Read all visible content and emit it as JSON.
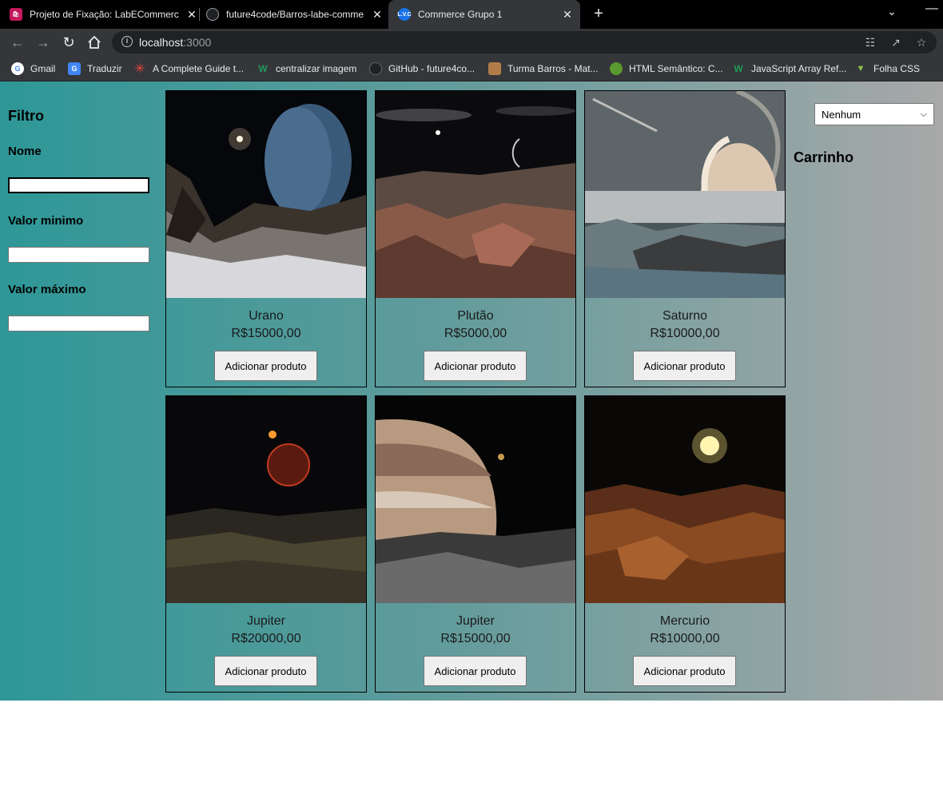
{
  "browser": {
    "tabs": [
      {
        "title": "Projeto de Fixação: LabECommerce",
        "active": false,
        "icon": "bag-icon"
      },
      {
        "title": "future4code/Barros-labe-commerce",
        "active": false,
        "icon": "github-icon"
      },
      {
        "title": "Commerce Grupo 1",
        "active": true,
        "icon": "lvc-icon",
        "icon_text": "L.V.C"
      }
    ],
    "url_host": "localhost",
    "url_port": ":3000",
    "bookmarks": [
      {
        "label": "Gmail",
        "icon": "google-icon",
        "color": "#ffffff"
      },
      {
        "label": "Traduzir",
        "icon": "translate-icon",
        "color": "#4285f4"
      },
      {
        "label": "A Complete Guide t...",
        "icon": "asterisk-icon",
        "color": "#e8453c"
      },
      {
        "label": "centralizar imagem",
        "icon": "w-icon",
        "color": "#1e9a5a"
      },
      {
        "label": "GitHub - future4co...",
        "icon": "github-icon",
        "color": "#202124"
      },
      {
        "label": "Turma Barros - Mat...",
        "icon": "avatar-icon",
        "color": "#b07d48"
      },
      {
        "label": "HTML Semântico: C...",
        "icon": "globe-icon",
        "color": "#5a9a2e"
      },
      {
        "label": "JavaScript Array Ref...",
        "icon": "w-icon",
        "color": "#1e9a5a"
      },
      {
        "label": "Folha CSS",
        "icon": "triangle-icon",
        "color": "#8bc34a"
      }
    ]
  },
  "filter": {
    "title": "Filtro",
    "name_label": "Nome",
    "name_value": "",
    "min_label": "Valor minimo",
    "min_value": "",
    "max_label": "Valor máximo",
    "max_value": ""
  },
  "products": [
    {
      "name": "Urano",
      "price": "R$15000,00",
      "button": "Adicionar produto",
      "scene": "urano"
    },
    {
      "name": "Plutão",
      "price": "R$5000,00",
      "button": "Adicionar produto",
      "scene": "plutao"
    },
    {
      "name": "Saturno",
      "price": "R$10000,00",
      "button": "Adicionar produto",
      "scene": "saturno"
    },
    {
      "name": "Jupiter",
      "price": "R$20000,00",
      "button": "Adicionar produto",
      "scene": "jupiter1"
    },
    {
      "name": "Jupiter",
      "price": "R$15000,00",
      "button": "Adicionar produto",
      "scene": "jupiter2"
    },
    {
      "name": "Mercurio",
      "price": "R$10000,00",
      "button": "Adicionar produto",
      "scene": "mercurio"
    }
  ],
  "sort": {
    "selected": "Nenhum"
  },
  "cart": {
    "title": "Carrinho"
  },
  "colors": {
    "page_gradient_start": "#2e9797",
    "page_gradient_end": "#a8a8a8"
  }
}
